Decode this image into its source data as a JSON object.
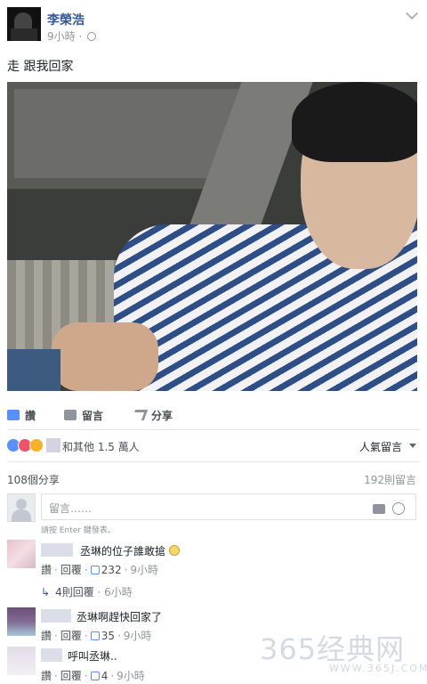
{
  "post": {
    "author": "李榮浩",
    "time": "9小時",
    "privacy_icon": "globe-icon",
    "text": "走 跟我回家"
  },
  "actions": {
    "like": "讚",
    "comment": "留言",
    "share": "分享"
  },
  "reactions": {
    "summary": "和其他 1.5 萬人",
    "sort_label": "人氣留言"
  },
  "stats": {
    "shares": "108個分享",
    "comments": "192則留言"
  },
  "composer": {
    "placeholder": "留言……",
    "hint": "請按 Enter 鍵發表。"
  },
  "comments": [
    {
      "text": "丞琳的位子誰敢搶",
      "like": "讚",
      "reply": "回覆",
      "likes": "232",
      "time": "9小時",
      "replies": "4則回覆",
      "replies_time": "6小時"
    },
    {
      "text": "丞琳啊趕快回家了",
      "like": "讚",
      "reply": "回覆",
      "likes": "35",
      "time": "9小時"
    },
    {
      "text": "呼叫丞琳..",
      "like": "讚",
      "reply": "回覆",
      "likes": "4",
      "time": "9小時"
    }
  ],
  "watermark": {
    "main": "365经典网",
    "sub": "WWW.365J.COM"
  },
  "colors": {
    "link_blue": "#365899",
    "like_blue": "#5890ff",
    "love_red": "#f25268",
    "haha_yellow": "#f7b125",
    "meta_gray": "#90949c"
  }
}
